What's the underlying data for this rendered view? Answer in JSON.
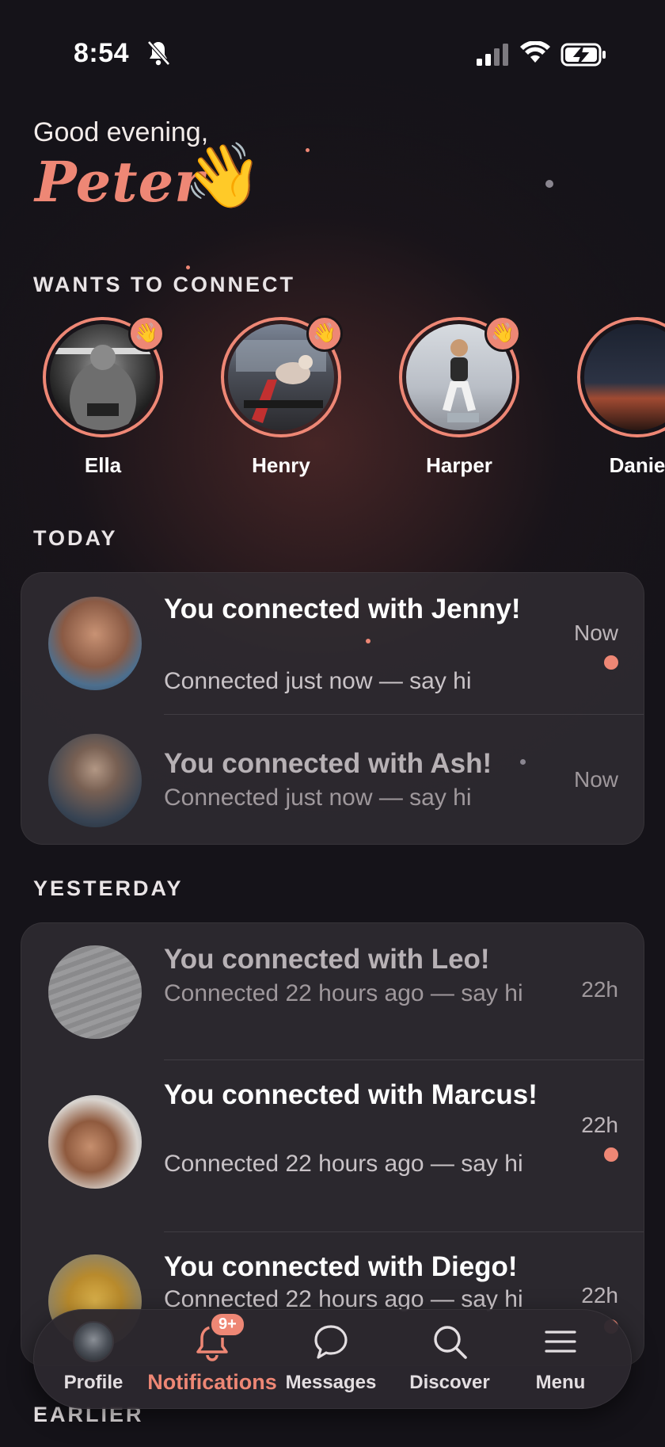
{
  "status_bar": {
    "time": "8:54"
  },
  "greeting": {
    "line": "Good evening,",
    "name": "Peter",
    "emoji": "👋"
  },
  "wants_to_connect": {
    "header": "WANTS TO CONNECT",
    "people": [
      {
        "name": "Ella",
        "badge": "👋"
      },
      {
        "name": "Henry",
        "badge": "👋"
      },
      {
        "name": "Harper",
        "badge": "👋"
      },
      {
        "name": "Danie"
      }
    ]
  },
  "today": {
    "header": "TODAY",
    "items": [
      {
        "title": "You connected with Jenny!",
        "subtitle": "Connected just now — say hi",
        "time": "Now",
        "unread": true
      },
      {
        "title": "You connected with Ash!",
        "subtitle": "Connected just now — say hi",
        "time": "Now",
        "unread": false
      }
    ]
  },
  "yesterday": {
    "header": "YESTERDAY",
    "items": [
      {
        "title": "You connected with Leo!",
        "subtitle": "Connected 22 hours ago — say hi",
        "time": "22h",
        "unread": false
      },
      {
        "title": "You connected with Marcus!",
        "subtitle": "Connected 22 hours ago — say hi",
        "time": "22h",
        "unread": true
      },
      {
        "title": "You connected with Diego!",
        "subtitle": "Connected 22 hours ago — say hi",
        "time": "22h",
        "unread": true
      }
    ]
  },
  "earlier": {
    "header": "EARLIER"
  },
  "tab_bar": {
    "tabs": [
      {
        "label": "Profile",
        "icon": "avatar"
      },
      {
        "label": "Notifications",
        "icon": "bell-icon",
        "badge": "9+",
        "active": true
      },
      {
        "label": "Messages",
        "icon": "chat-bubble-icon"
      },
      {
        "label": "Discover",
        "icon": "search-icon"
      },
      {
        "label": "Menu",
        "icon": "hamburger-icon"
      }
    ]
  },
  "colors": {
    "accent": "#ee8775",
    "background": "#151319",
    "card": "#34303a"
  }
}
